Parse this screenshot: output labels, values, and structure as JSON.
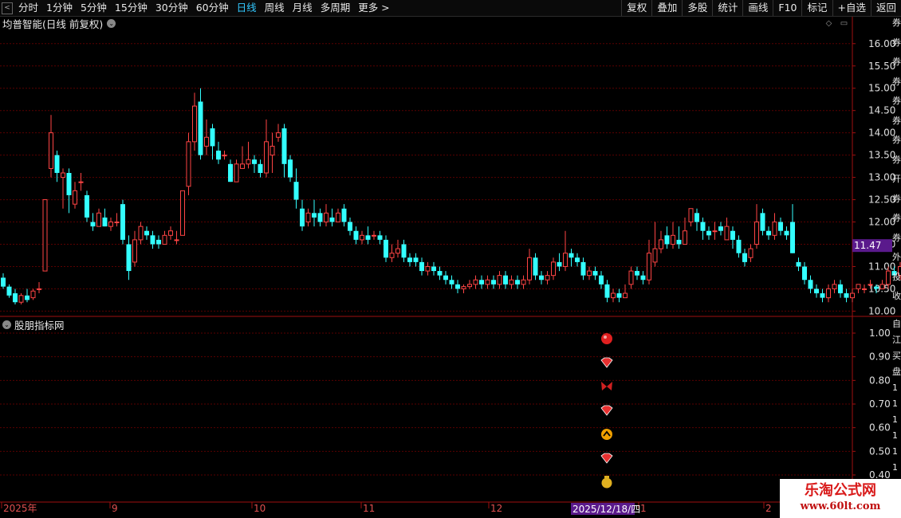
{
  "toolbar": {
    "periods": [
      "分时",
      "1分钟",
      "5分钟",
      "15分钟",
      "30分钟",
      "60分钟",
      "日线",
      "周线",
      "月线",
      "多周期",
      "更多 >"
    ],
    "active_period": "日线",
    "buttons": [
      "复权",
      "叠加",
      "多股",
      "统计",
      "画线",
      "F10",
      "标记",
      "+自选",
      "返回"
    ]
  },
  "main_title": "均普智能(日线 前复权)",
  "sub_title": "股朋指标网",
  "price_axis": [
    "16.00",
    "15.50",
    "15.00",
    "14.50",
    "14.00",
    "13.50",
    "13.00",
    "12.50",
    "12.00",
    "11.50",
    "11.00",
    "10.50",
    "10.00"
  ],
  "current_price": "11.47",
  "indicator_axis": [
    "1.00",
    "0.90",
    "0.80",
    "0.70",
    "0.60",
    "0.50",
    "0.40"
  ],
  "time_axis": [
    "2025年",
    "9",
    "10",
    "11",
    "12",
    "1",
    "2"
  ],
  "cursor_date": "2025/12/18/四",
  "watermark": {
    "name": "乐淘公式网",
    "url": "www.60lt.com"
  },
  "colors": {
    "up": "#ff4444",
    "down": "#33ffff",
    "grid": "#5a0000",
    "axis": "#a01010",
    "price_tag": "#5a1a8c"
  },
  "signal_icons": [
    "red-ball-icon",
    "red-gem-icon",
    "red-butterfly-icon",
    "red-gem-icon",
    "orange-arrow-icon",
    "red-gem-icon",
    "money-bag-icon"
  ],
  "right_strip": [
    "券",
    "券",
    "券",
    "券",
    "券",
    "券",
    "券",
    "券",
    "开",
    "券",
    "券",
    "券",
    "外",
    "投",
    "收"
  ],
  "right_strip_lower": [
    "自",
    "江",
    "买",
    "盘",
    "1",
    "1",
    "1",
    "1",
    "1",
    "1"
  ],
  "chart_data": {
    "type": "candlestick",
    "ylim": [
      9.9,
      16.3
    ],
    "candles": [
      [
        10.75,
        10.55,
        10.85,
        10.5
      ],
      [
        10.55,
        10.35,
        10.6,
        10.3
      ],
      [
        10.4,
        10.2,
        10.5,
        10.15
      ],
      [
        10.2,
        10.35,
        10.4,
        10.15
      ],
      [
        10.35,
        10.25,
        10.5,
        10.2
      ],
      [
        10.3,
        10.45,
        10.5,
        10.25
      ],
      [
        10.5,
        10.5,
        10.65,
        10.4
      ],
      [
        10.9,
        12.5,
        12.5,
        10.9
      ],
      [
        13.2,
        14.0,
        14.4,
        13.0
      ],
      [
        13.5,
        13.1,
        13.6,
        12.9
      ],
      [
        13.0,
        13.1,
        13.2,
        12.3
      ],
      [
        13.1,
        12.6,
        13.2,
        12.2
      ],
      [
        12.4,
        12.7,
        12.9,
        12.3
      ],
      [
        12.9,
        12.9,
        13.1,
        12.7
      ],
      [
        12.6,
        12.1,
        12.7,
        12.0
      ],
      [
        12.0,
        11.9,
        12.2,
        11.8
      ],
      [
        11.9,
        12.2,
        12.3,
        11.9
      ],
      [
        12.1,
        11.9,
        12.3,
        11.9
      ],
      [
        11.9,
        12.0,
        12.1,
        11.8
      ],
      [
        12.0,
        12.0,
        12.2,
        11.9
      ],
      [
        12.4,
        11.6,
        12.5,
        11.5
      ],
      [
        11.5,
        10.9,
        11.7,
        10.7
      ],
      [
        11.1,
        11.6,
        11.8,
        11.0
      ],
      [
        11.6,
        11.9,
        12.0,
        11.5
      ],
      [
        11.8,
        11.7,
        11.9,
        11.6
      ],
      [
        11.7,
        11.5,
        11.8,
        11.4
      ],
      [
        11.6,
        11.5,
        11.7,
        11.4
      ],
      [
        11.5,
        11.7,
        11.8,
        11.5
      ],
      [
        11.7,
        11.8,
        11.9,
        11.6
      ],
      [
        11.6,
        11.6,
        11.8,
        11.5
      ],
      [
        11.7,
        12.7,
        12.7,
        11.7
      ],
      [
        12.8,
        13.8,
        14.0,
        12.6
      ],
      [
        13.8,
        14.6,
        14.9,
        13.6
      ],
      [
        14.7,
        13.5,
        15.0,
        13.4
      ],
      [
        13.7,
        13.9,
        14.3,
        13.5
      ],
      [
        14.1,
        13.7,
        14.2,
        13.4
      ],
      [
        13.6,
        13.4,
        13.8,
        13.3
      ],
      [
        13.5,
        13.5,
        13.6,
        13.4
      ],
      [
        13.3,
        12.9,
        13.4,
        12.9
      ],
      [
        12.9,
        13.3,
        13.4,
        12.9
      ],
      [
        13.2,
        13.3,
        13.7,
        13.2
      ],
      [
        13.3,
        13.4,
        13.8,
        13.2
      ],
      [
        13.4,
        13.3,
        13.5,
        13.1
      ],
      [
        13.3,
        13.1,
        13.4,
        13.0
      ],
      [
        13.1,
        13.8,
        14.3,
        13.0
      ],
      [
        13.5,
        13.7,
        14.0,
        13.1
      ],
      [
        13.9,
        14.0,
        14.2,
        13.8
      ],
      [
        14.1,
        13.3,
        14.2,
        13.0
      ],
      [
        13.4,
        13.0,
        13.5,
        12.9
      ],
      [
        12.9,
        12.5,
        13.2,
        12.3
      ],
      [
        12.3,
        11.9,
        12.5,
        11.8
      ],
      [
        12.0,
        12.2,
        12.3,
        11.9
      ],
      [
        12.2,
        12.1,
        12.5,
        11.9
      ],
      [
        12.2,
        12.0,
        12.3,
        11.9
      ],
      [
        12.0,
        12.2,
        12.4,
        11.9
      ],
      [
        12.1,
        12.0,
        12.3,
        11.9
      ],
      [
        12.0,
        12.2,
        12.3,
        12.0
      ],
      [
        12.3,
        12.0,
        12.4,
        11.9
      ],
      [
        12.0,
        11.8,
        12.1,
        11.7
      ],
      [
        11.8,
        11.6,
        11.9,
        11.5
      ],
      [
        11.6,
        11.7,
        11.8,
        11.5
      ],
      [
        11.7,
        11.6,
        11.9,
        11.5
      ],
      [
        11.7,
        11.7,
        11.8,
        11.6
      ],
      [
        11.7,
        11.6,
        11.8,
        11.5
      ],
      [
        11.6,
        11.2,
        11.7,
        11.1
      ],
      [
        11.2,
        11.3,
        11.5,
        11.1
      ],
      [
        11.3,
        11.4,
        11.6,
        11.2
      ],
      [
        11.5,
        11.2,
        11.6,
        11.1
      ],
      [
        11.2,
        11.1,
        11.3,
        11.0
      ],
      [
        11.2,
        11.1,
        11.3,
        11.0
      ],
      [
        11.1,
        10.9,
        11.2,
        10.8
      ],
      [
        10.9,
        11.0,
        11.1,
        10.8
      ],
      [
        11.0,
        10.9,
        11.1,
        10.8
      ],
      [
        10.9,
        10.8,
        11.0,
        10.7
      ],
      [
        10.8,
        10.7,
        10.9,
        10.6
      ],
      [
        10.7,
        10.6,
        10.8,
        10.5
      ],
      [
        10.6,
        10.5,
        10.7,
        10.4
      ],
      [
        10.5,
        10.55,
        10.6,
        10.4
      ],
      [
        10.55,
        10.6,
        10.7,
        10.5
      ],
      [
        10.6,
        10.7,
        10.8,
        10.5
      ],
      [
        10.7,
        10.6,
        10.8,
        10.5
      ],
      [
        10.6,
        10.7,
        10.8,
        10.5
      ],
      [
        10.7,
        10.6,
        10.8,
        10.5
      ],
      [
        10.6,
        10.8,
        10.9,
        10.5
      ],
      [
        10.8,
        10.6,
        10.9,
        10.5
      ],
      [
        10.6,
        10.7,
        10.8,
        10.5
      ],
      [
        10.7,
        10.6,
        10.8,
        10.5
      ],
      [
        10.6,
        10.7,
        10.8,
        10.5
      ],
      [
        10.7,
        11.2,
        11.4,
        10.6
      ],
      [
        11.2,
        10.8,
        11.3,
        10.7
      ],
      [
        10.8,
        10.7,
        10.9,
        10.6
      ],
      [
        10.7,
        10.8,
        10.9,
        10.6
      ],
      [
        10.8,
        11.1,
        11.2,
        10.7
      ],
      [
        11.1,
        11.0,
        11.3,
        10.9
      ],
      [
        11.0,
        11.3,
        11.8,
        10.9
      ],
      [
        11.3,
        11.2,
        11.4,
        11.0
      ],
      [
        11.2,
        11.1,
        11.3,
        11.0
      ],
      [
        11.1,
        10.8,
        11.2,
        10.7
      ],
      [
        10.8,
        10.9,
        11.0,
        10.7
      ],
      [
        10.9,
        10.8,
        11.0,
        10.7
      ],
      [
        10.8,
        10.6,
        10.9,
        10.5
      ],
      [
        10.6,
        10.3,
        10.7,
        10.2
      ],
      [
        10.3,
        10.4,
        10.5,
        10.2
      ],
      [
        10.4,
        10.3,
        10.5,
        10.2
      ],
      [
        10.3,
        10.4,
        10.6,
        10.3
      ],
      [
        10.6,
        10.9,
        11.0,
        10.5
      ],
      [
        10.9,
        10.8,
        11.0,
        10.7
      ],
      [
        10.8,
        10.7,
        10.9,
        10.6
      ],
      [
        10.7,
        11.3,
        11.6,
        10.6
      ],
      [
        11.1,
        11.4,
        12.0,
        11.0
      ],
      [
        11.4,
        11.6,
        11.8,
        11.3
      ],
      [
        11.7,
        11.5,
        11.9,
        11.4
      ],
      [
        11.5,
        11.7,
        12.0,
        11.4
      ],
      [
        11.6,
        11.5,
        11.9,
        11.4
      ],
      [
        11.5,
        11.8,
        12.1,
        11.5
      ],
      [
        12.0,
        12.3,
        12.3,
        11.9
      ],
      [
        12.2,
        12.0,
        12.3,
        11.8
      ],
      [
        12.0,
        11.8,
        12.1,
        11.6
      ],
      [
        11.8,
        11.7,
        11.9,
        11.6
      ],
      [
        11.8,
        11.8,
        12.0,
        11.6
      ],
      [
        11.9,
        11.8,
        12.0,
        11.7
      ],
      [
        11.6,
        11.9,
        12.1,
        11.6
      ],
      [
        11.8,
        11.6,
        11.9,
        11.4
      ],
      [
        11.6,
        11.3,
        11.7,
        11.2
      ],
      [
        11.3,
        11.1,
        11.4,
        11.0
      ],
      [
        11.2,
        11.4,
        11.5,
        11.1
      ],
      [
        11.5,
        12.0,
        12.4,
        11.4
      ],
      [
        12.2,
        11.8,
        12.3,
        11.7
      ],
      [
        11.8,
        11.7,
        11.9,
        11.6
      ],
      [
        11.7,
        12.0,
        12.2,
        11.6
      ],
      [
        12.0,
        11.8,
        12.1,
        11.7
      ],
      [
        11.8,
        11.7,
        11.9,
        11.6
      ],
      [
        12.0,
        11.3,
        12.4,
        11.3
      ],
      [
        11.1,
        11.0,
        11.2,
        10.9
      ],
      [
        11.0,
        10.7,
        11.1,
        10.6
      ],
      [
        10.7,
        10.5,
        10.8,
        10.4
      ],
      [
        10.5,
        10.4,
        10.6,
        10.3
      ],
      [
        10.4,
        10.3,
        10.5,
        10.2
      ],
      [
        10.3,
        10.5,
        10.6,
        10.2
      ],
      [
        10.5,
        10.6,
        10.7,
        10.4
      ],
      [
        10.6,
        10.4,
        10.7,
        10.3
      ],
      [
        10.4,
        10.3,
        10.5,
        10.2
      ],
      [
        10.3,
        10.4,
        10.5,
        10.2
      ],
      [
        10.5,
        10.6,
        10.6,
        10.4
      ],
      [
        10.5,
        10.5,
        10.6,
        10.4
      ],
      [
        10.6,
        10.6,
        10.7,
        10.5
      ],
      [
        10.55,
        10.5,
        10.6,
        10.4
      ],
      [
        10.5,
        10.6,
        10.7,
        10.5
      ],
      [
        10.6,
        10.9,
        11.0,
        10.5
      ],
      [
        10.9,
        10.8,
        11.0,
        10.7
      ],
      [
        10.8,
        11.0,
        11.1,
        10.7
      ],
      [
        11.0,
        11.1,
        11.2,
        10.8
      ]
    ]
  }
}
